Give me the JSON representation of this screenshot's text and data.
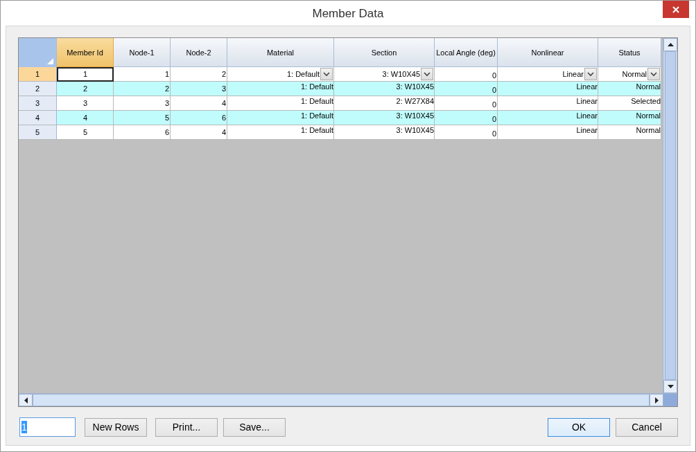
{
  "window": {
    "title": "Member Data"
  },
  "table": {
    "columns": [
      {
        "label": "Member Id",
        "kind": "id",
        "selected": true
      },
      {
        "label": "Node-1",
        "kind": "number",
        "selected": false
      },
      {
        "label": "Node-2",
        "kind": "number",
        "selected": false
      },
      {
        "label": "Material",
        "kind": "combo",
        "selected": false
      },
      {
        "label": "Section",
        "kind": "combo",
        "selected": false
      },
      {
        "label": "Local Angle (deg)",
        "kind": "number",
        "selected": false
      },
      {
        "label": "Nonlinear",
        "kind": "combo",
        "selected": false
      },
      {
        "label": "Status",
        "kind": "combo",
        "selected": false
      }
    ],
    "rows": [
      {
        "header": "1",
        "current": true,
        "shaded": false,
        "cells": [
          "1",
          "1",
          "2",
          "1: Default",
          "3: W10X45",
          "0",
          "Linear",
          "Normal"
        ]
      },
      {
        "header": "2",
        "current": false,
        "shaded": true,
        "cells": [
          "2",
          "2",
          "3",
          "1: Default",
          "3: W10X45",
          "0",
          "Linear",
          "Normal"
        ]
      },
      {
        "header": "3",
        "current": false,
        "shaded": false,
        "cells": [
          "3",
          "3",
          "4",
          "1: Default",
          "2: W27X84",
          "0",
          "Linear",
          "Selected"
        ]
      },
      {
        "header": "4",
        "current": false,
        "shaded": true,
        "cells": [
          "4",
          "5",
          "6",
          "1: Default",
          "3: W10X45",
          "0",
          "Linear",
          "Normal"
        ]
      },
      {
        "header": "5",
        "current": false,
        "shaded": false,
        "cells": [
          "5",
          "6",
          "4",
          "1: Default",
          "3: W10X45",
          "0",
          "Linear",
          "Normal"
        ]
      }
    ]
  },
  "row_count_field": {
    "value": "1"
  },
  "left_buttons": [
    {
      "label": "New Rows",
      "focused": false
    },
    {
      "label": "Print...",
      "focused": false
    },
    {
      "label": "Save...",
      "focused": false
    }
  ],
  "right_buttons": [
    {
      "label": "OK",
      "focused": true
    },
    {
      "label": "Cancel",
      "focused": false
    }
  ]
}
